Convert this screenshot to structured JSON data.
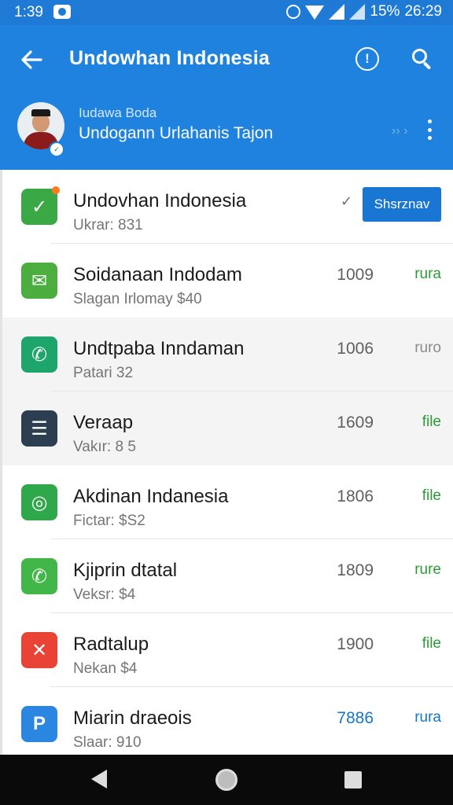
{
  "status_bar": {
    "time": "1:39",
    "battery": "15%",
    "clock_right": "26:29",
    "icons": [
      "download-icon",
      "alarm-icon",
      "wifi-icon",
      "signal-icon",
      "signal-icon"
    ]
  },
  "app_bar": {
    "title": "Undowhan Indonesia",
    "back_icon": "arrow-left-icon",
    "info_icon": "info-icon",
    "search_icon": "search-icon",
    "info_glyph": "!"
  },
  "profile": {
    "name": "Iudawa Boda",
    "subtitle": "Undogann Urlahanis Tajon",
    "arrows": "›› ›",
    "badge": "✓",
    "more_icon": "more-vertical-icon"
  },
  "colors": {
    "primary": "#1e82de",
    "status_bar": "#1f7ad6",
    "button": "#1976d2",
    "green_unit": "#2e9a37",
    "blue_unit": "#1676c7"
  },
  "list": [
    {
      "name": "Undovhan Indonesia",
      "meta": "Ukrar: 831",
      "icon": "email-check-icon",
      "icon_color": "#3aa845",
      "icon_glyph": "✓",
      "has_badge_dot": true,
      "shaded": false,
      "action_label": "Shsrznav",
      "check": "✓"
    },
    {
      "name": "Soidanaan Indodam",
      "meta": "Slagan Irlomay $40",
      "icon": "chat-bubble-icon",
      "icon_color": "#4cae3f",
      "icon_glyph": "✉",
      "shaded": false,
      "value": "1009",
      "unit": "rura",
      "unit_color": "green"
    },
    {
      "name": "Undtpaba Inndaman",
      "meta": "Patari 32",
      "icon": "message-icon",
      "icon_color": "#1ea56c",
      "icon_glyph": "✆",
      "shaded": true,
      "value": "1006",
      "unit": "ruro",
      "unit_color": "gray"
    },
    {
      "name": "Veraap",
      "meta": "Vakır: 8 5",
      "icon": "document-list-icon",
      "icon_color": "#2c3e50",
      "icon_glyph": "☰",
      "shaded": true,
      "value": "1609",
      "unit": "file",
      "unit_color": "green"
    },
    {
      "name": "Akdinan Indanesia",
      "meta": "Fictar: $S2",
      "icon": "camera-icon",
      "icon_color": "#2ea84a",
      "icon_glyph": "◎",
      "shaded": false,
      "value": "1806",
      "unit": "file",
      "unit_color": "green"
    },
    {
      "name": "Kjiprin dtatal",
      "meta": "Veksr: $4",
      "icon": "whatsapp-icon",
      "icon_color": "#43b649",
      "icon_glyph": "✆",
      "shaded": false,
      "value": "1809",
      "unit": "rure",
      "unit_color": "green"
    },
    {
      "name": "Radtalup",
      "meta": "Nekan $4",
      "icon": "close-circle-icon",
      "icon_color": "#e84335",
      "icon_glyph": "✕",
      "shaded": false,
      "value": "1900",
      "unit": "file",
      "unit_color": "green"
    },
    {
      "name": "Miarin draeois",
      "meta": "Slaar: 910",
      "icon": "p-app-icon",
      "icon_color": "#2a86e0",
      "icon_glyph": "P",
      "shaded": false,
      "value": "7886",
      "unit": "rura",
      "unit_color": "blue"
    }
  ],
  "nav_bar": {
    "back_icon": "nav-back-icon",
    "home_icon": "nav-home-icon",
    "recent_icon": "nav-recent-icon"
  }
}
